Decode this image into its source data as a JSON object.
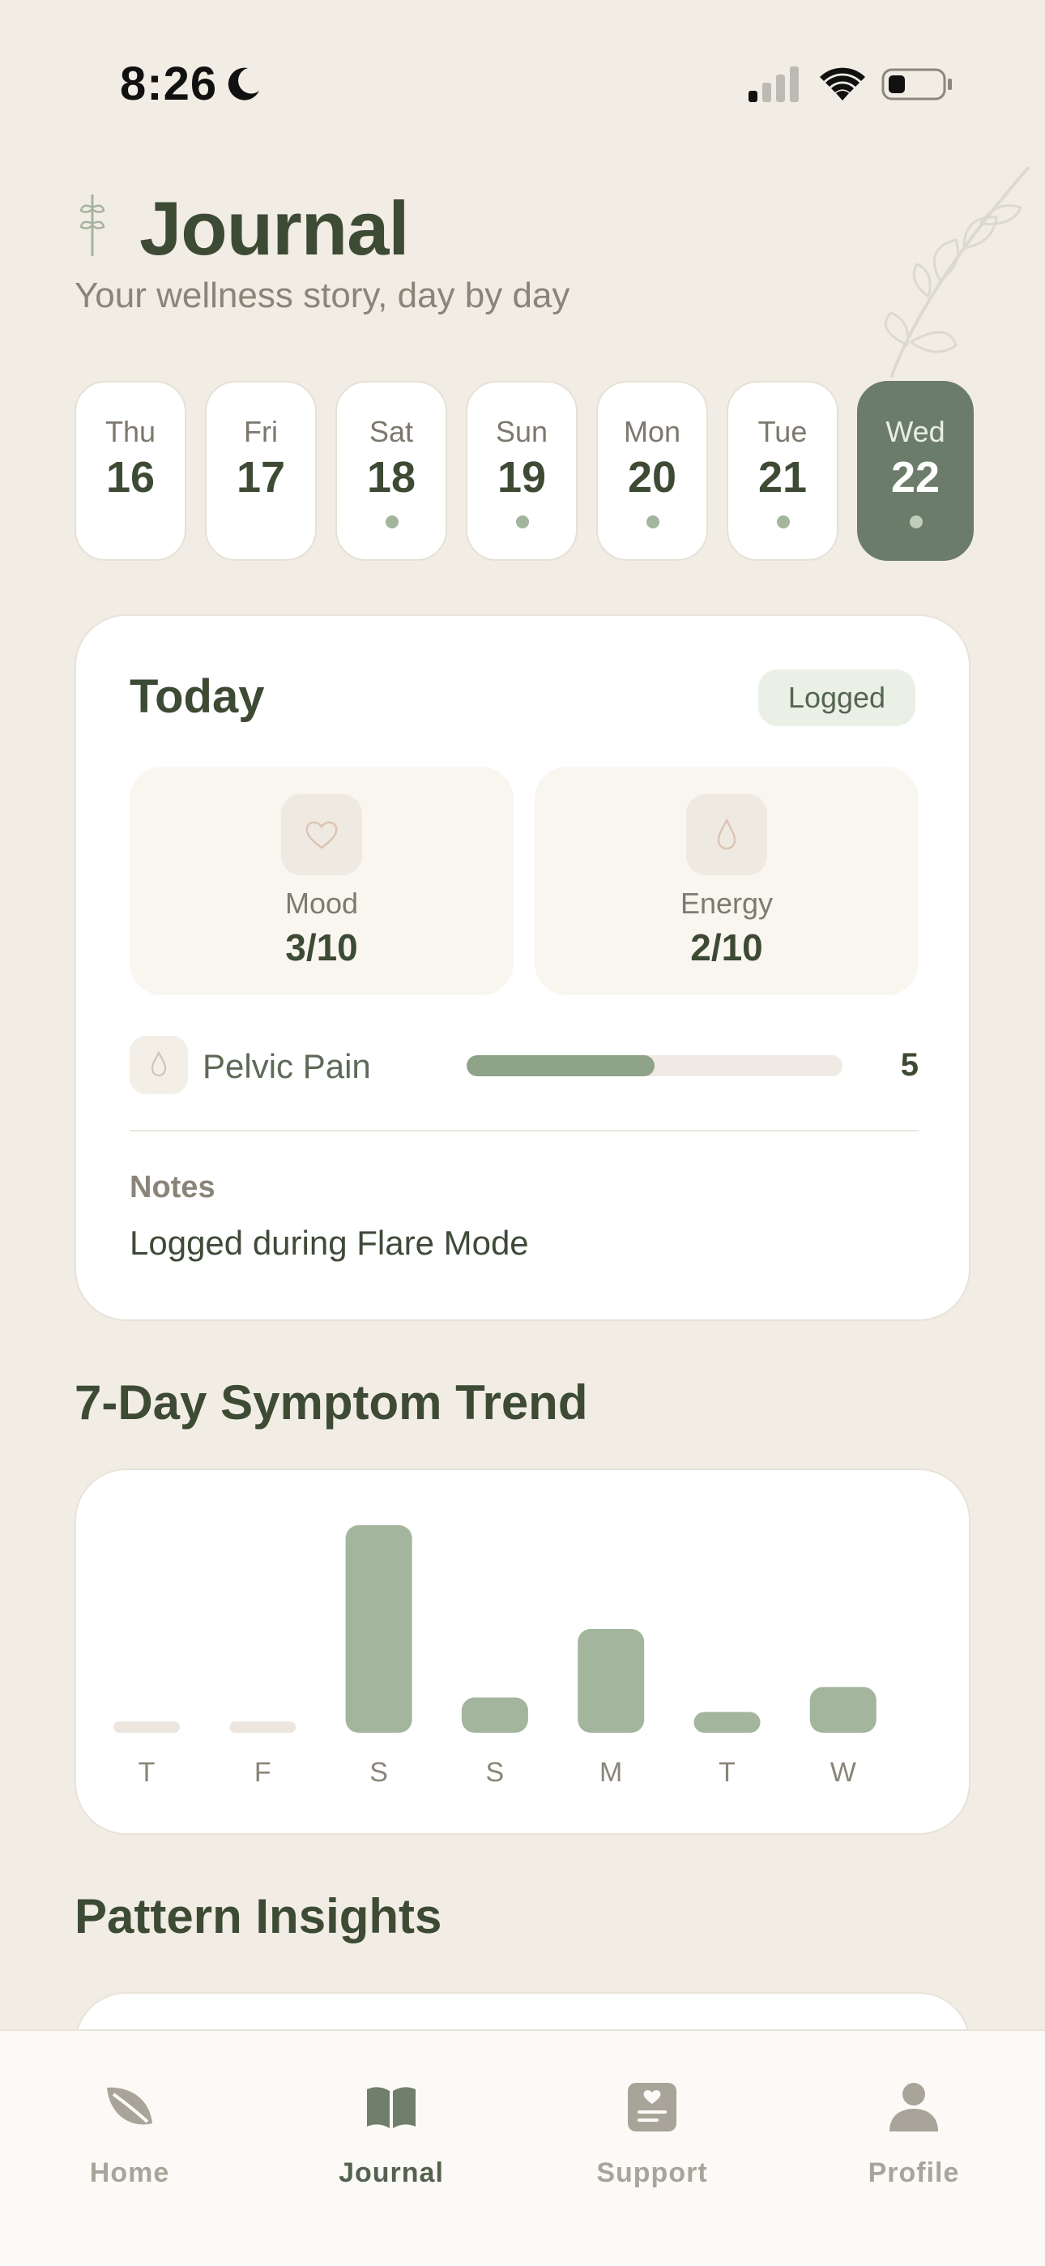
{
  "status_bar": {
    "time": "8:26",
    "focus_icon": "moon-icon",
    "signal_icon": "cellular-signal-icon",
    "wifi_icon": "wifi-icon",
    "battery_icon": "battery-icon"
  },
  "header": {
    "title": "Journal",
    "subtitle": "Your wellness story, day by day"
  },
  "days": [
    {
      "name": "Thu",
      "num": "16",
      "logged": false,
      "selected": false
    },
    {
      "name": "Fri",
      "num": "17",
      "logged": false,
      "selected": false
    },
    {
      "name": "Sat",
      "num": "18",
      "logged": true,
      "selected": false
    },
    {
      "name": "Sun",
      "num": "19",
      "logged": true,
      "selected": false
    },
    {
      "name": "Mon",
      "num": "20",
      "logged": true,
      "selected": false
    },
    {
      "name": "Tue",
      "num": "21",
      "logged": true,
      "selected": false
    },
    {
      "name": "Wed",
      "num": "22",
      "logged": true,
      "selected": true
    }
  ],
  "today": {
    "title": "Today",
    "badge": "Logged",
    "mood": {
      "label": "Mood",
      "value": "3/10",
      "icon": "heart-icon"
    },
    "energy": {
      "label": "Energy",
      "value": "2/10",
      "icon": "drop-icon"
    },
    "pelvic_pain": {
      "label": "Pelvic Pain",
      "value": "5",
      "level": 0.5,
      "icon": "drop-icon"
    },
    "notes_label": "Notes",
    "notes_text": "Logged during Flare Mode"
  },
  "trend": {
    "title": "7-Day Symptom Trend"
  },
  "chart_data": {
    "type": "bar",
    "categories": [
      "T",
      "F",
      "S",
      "S",
      "M",
      "T",
      "W"
    ],
    "values": [
      0,
      0,
      10,
      1.7,
      5,
      1,
      2.2
    ],
    "ylim": [
      0,
      10
    ],
    "grid": false,
    "colors": {
      "bar": "#a3b59d",
      "empty": "#ece6df"
    }
  },
  "insights": {
    "title": "Pattern Insights"
  },
  "tabs": [
    {
      "label": "Home",
      "icon": "leaf-icon",
      "active": false
    },
    {
      "label": "Journal",
      "icon": "book-icon",
      "active": true
    },
    {
      "label": "Support",
      "icon": "message-icon",
      "active": false
    },
    {
      "label": "Profile",
      "icon": "person-icon",
      "active": false
    }
  ],
  "colors": {
    "background": "#f1ede5",
    "accent": "#6b7c6a",
    "heading": "#3d4a34"
  }
}
